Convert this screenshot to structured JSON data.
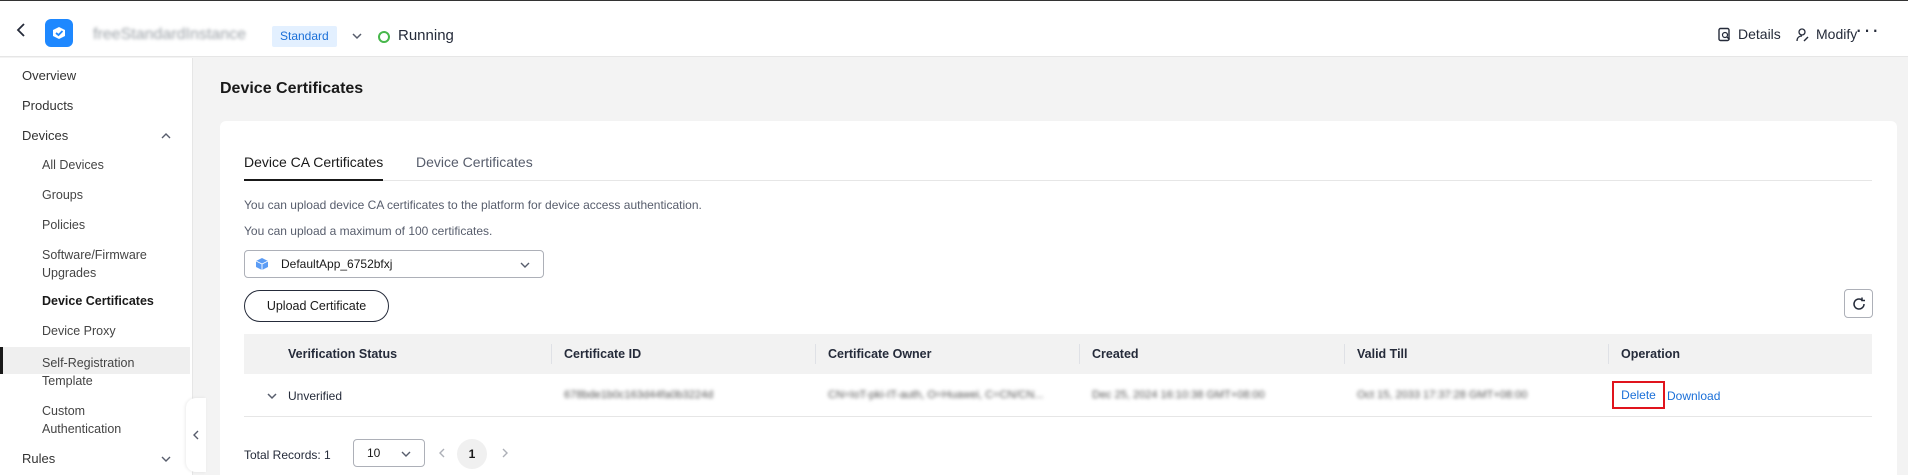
{
  "header": {
    "instance_name": "freeStandardInstance",
    "edition_tag": "Standard",
    "status": "Running",
    "details_label": "Details",
    "modify_label": "Modify",
    "more_label": "···"
  },
  "sidebar": {
    "items": [
      {
        "label": "Overview"
      },
      {
        "label": "Products"
      },
      {
        "label": "Devices"
      }
    ],
    "devices_children": [
      {
        "label": "All Devices"
      },
      {
        "label": "Groups"
      },
      {
        "label": "Policies"
      },
      {
        "label": "Software/Firmware Upgrades"
      },
      {
        "label": "Device Certificates"
      },
      {
        "label": "Device Proxy"
      },
      {
        "label": "Self-Registration Template"
      },
      {
        "label": "Custom Authentication"
      }
    ],
    "rules_label": "Rules",
    "active_item": "Device Certificates"
  },
  "main": {
    "page_title": "Device Certificates",
    "tabs": [
      {
        "label": "Device CA Certificates",
        "active": true
      },
      {
        "label": "Device Certificates",
        "active": false
      }
    ],
    "info_lines": [
      "You can upload device CA certificates to the platform for device access authentication.",
      "You can upload a maximum of 100 certificates."
    ],
    "app_selector": {
      "value": "DefaultApp_6752bfxj"
    },
    "upload_button": "Upload Certificate"
  },
  "table": {
    "columns": [
      "Verification Status",
      "Certificate ID",
      "Certificate Owner",
      "Created",
      "Valid Till",
      "Operation"
    ],
    "rows": [
      {
        "status": "Unverified",
        "certificate_id": "678bde1b0c163d44fa0b3224d",
        "owner": "CN=IoT-pki-IT-auth, O=Huawei, C=CN/CN...",
        "created": "Dec 25, 2024 16:10:38 GMT+08:00",
        "valid_till": "Oct 15, 2033 17:37:28 GMT+08:00",
        "op_delete": "Delete",
        "op_download": "Download"
      }
    ]
  },
  "pagination": {
    "total_label": "Total Records: 1",
    "page_size": "10",
    "current_page": "1"
  },
  "colors": {
    "accent": "#1e88ff",
    "link": "#1a6fd8",
    "running": "#47b74b",
    "highlight_border": "#e0141d"
  }
}
